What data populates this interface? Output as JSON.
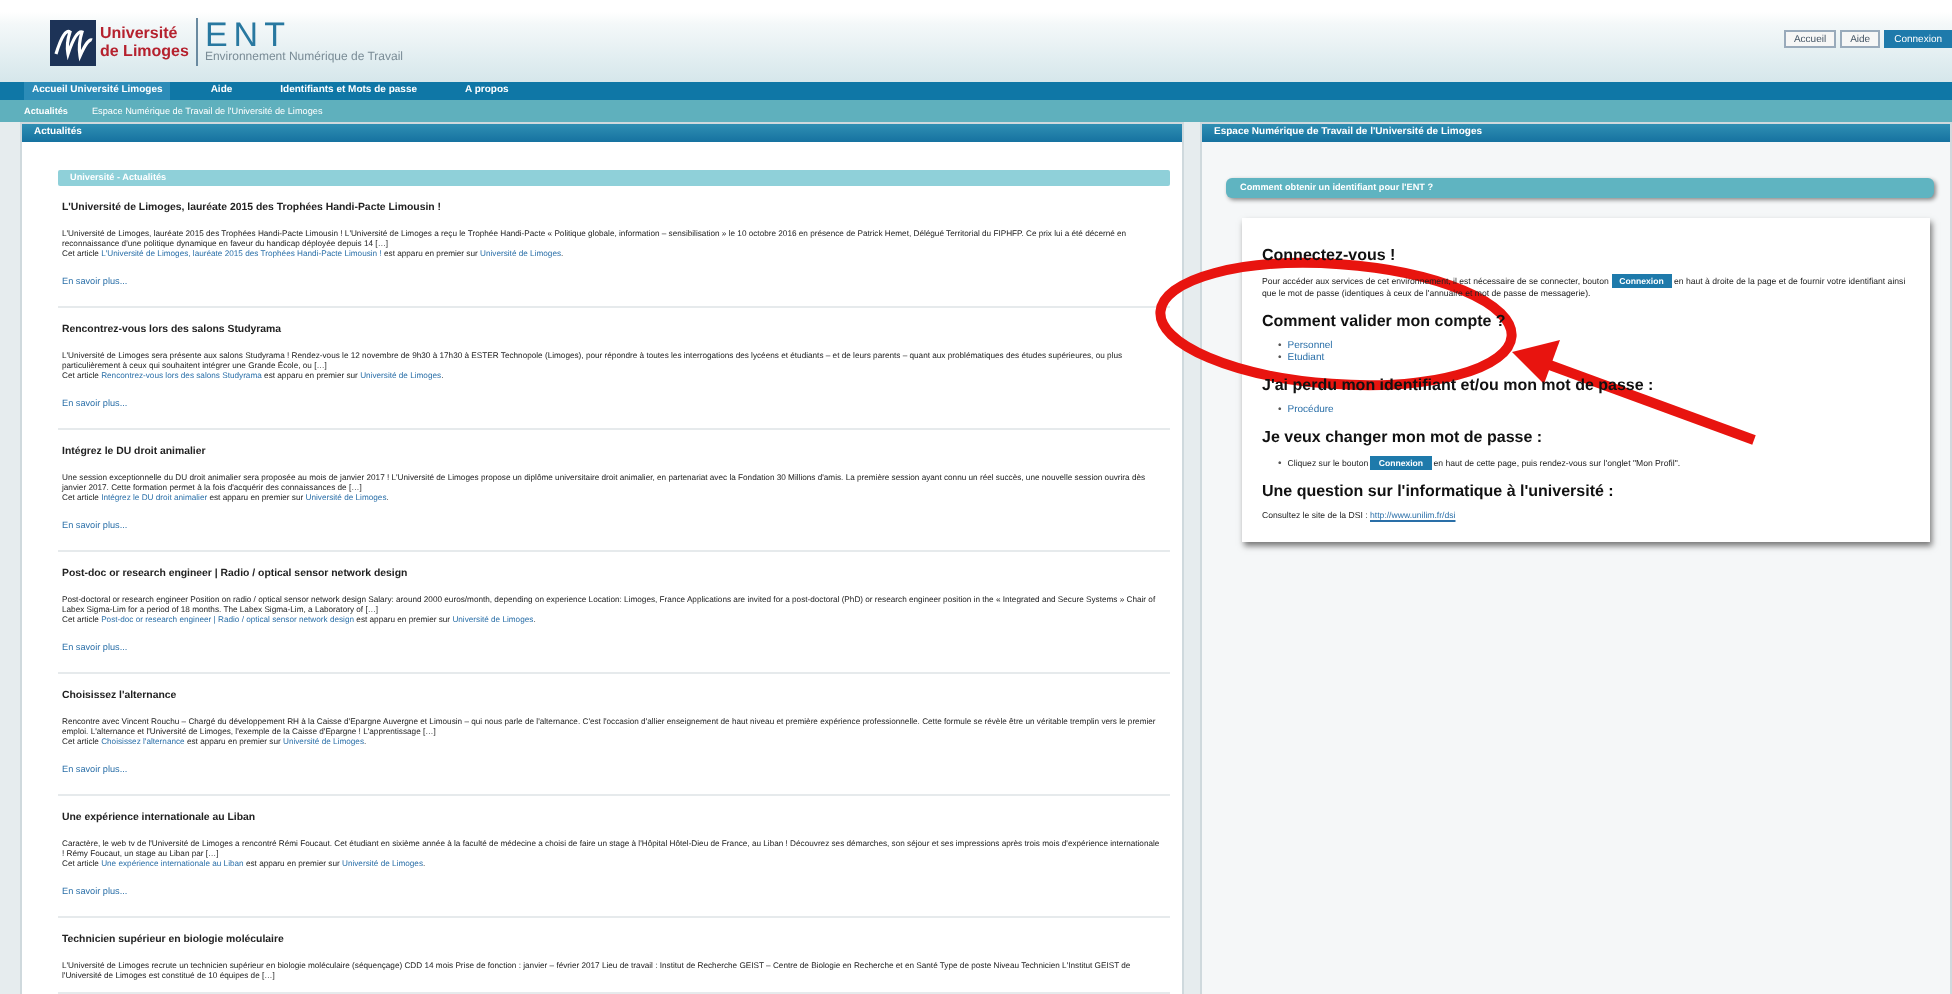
{
  "header": {
    "university": [
      "Université",
      "de Limoges"
    ],
    "app_name": "ENT",
    "app_subtitle": "Environnement Numérique de Travail",
    "top_buttons": [
      {
        "label": "Accueil",
        "selected": false
      },
      {
        "label": "Aide",
        "selected": false
      },
      {
        "label": "Connexion",
        "selected": true
      }
    ]
  },
  "nav": [
    {
      "label": "Accueil Université Limoges",
      "selected": true
    },
    {
      "label": "Aide",
      "selected": false
    },
    {
      "label": "Identifiants et Mots de passe",
      "selected": false
    },
    {
      "label": "A propos",
      "selected": false
    }
  ],
  "subnav": [
    {
      "label": "Actualités",
      "selected": true
    },
    {
      "label": "Espace Numérique de Travail de l'Université de Limoges",
      "selected": false
    }
  ],
  "left_panel": {
    "title": "Actualités",
    "section_title": "Université - Actualités",
    "articles": [
      {
        "title": "L'Université de Limoges, lauréate 2015 des Trophées Handi-Pacte Limousin !",
        "body": "L'Université de Limoges, lauréate 2015 des Trophées Handi-Pacte Limousin ! L'Université de Limoges a reçu le Trophée Handi-Pacte « Politique globale, information – sensibilisation » le 10 octobre 2016 en présence de Patrick Hemet, Délégué Territorial du FIPHFP. Ce prix lui a été décerné en reconnaissance d'une politique dynamique en faveur du handicap déployée depuis 14 […]",
        "cite_prefix": "Cet article",
        "cite_link": "L'Université de Limoges, lauréate 2015 des Trophées Handi-Pacte Limousin !",
        "cite_middle": "est apparu en premier sur",
        "site_link": "Université de Limoges",
        "cite_end": ".",
        "more": "En savoir plus..."
      },
      {
        "title": "Rencontrez-vous lors des salons Studyrama",
        "body": "L'Université de Limoges sera présente aux salons Studyrama ! Rendez-vous le 12 novembre de 9h30 à 17h30 à ESTER Technopole (Limoges), pour répondre à toutes les interrogations des lycéens et étudiants – et de leurs parents – quant aux problématiques des études supérieures, ou plus particulièrement à ceux qui souhaitent intégrer une Grande École, ou […]",
        "cite_prefix": "Cet article",
        "cite_link": "Rencontrez-vous lors des salons Studyrama",
        "cite_middle": "est apparu en premier sur",
        "site_link": "Université de Limoges",
        "cite_end": ".",
        "more": "En savoir plus..."
      },
      {
        "title": "Intégrez le DU droit animalier",
        "body": "Une session exceptionnelle du DU droit animalier sera proposée au mois de janvier 2017 ! L'Université de Limoges propose un diplôme universitaire droit animalier, en partenariat avec la Fondation 30 Millions d'amis. La première session ayant connu un réel succès, une nouvelle session ouvrira dès janvier 2017. Cette formation permet à la fois d'acquérir des connaissances de […]",
        "cite_prefix": "Cet article",
        "cite_link": "Intégrez le DU droit animalier",
        "cite_middle": "est apparu en premier sur",
        "site_link": "Université de Limoges",
        "cite_end": ".",
        "more": "En savoir plus..."
      },
      {
        "title": "Post-doc or research engineer | Radio / optical sensor network design",
        "body": "Post-doctoral or research engineer Position on radio / optical sensor network design Salary: around 2000 euros/month, depending on experience Location: Limoges, France Applications are invited for a post-doctoral (PhD) or research engineer position in the « Integrated and Secure Systems » Chair of Labex Sigma-Lim for a period of 18 months. The Labex Sigma-Lim, a Laboratory of […]",
        "cite_prefix": "Cet article",
        "cite_link": "Post-doc or research engineer | Radio / optical sensor network design",
        "cite_middle": "est apparu en premier sur",
        "site_link": "Université de Limoges",
        "cite_end": ".",
        "more": "En savoir plus..."
      },
      {
        "title": "Choisissez l'alternance",
        "body": "Rencontre avec Vincent Rouchu – Chargé du développement RH à la Caisse d'Epargne Auvergne et Limousin – qui nous parle de l'alternance. C'est l'occasion d'allier enseignement de haut niveau et première expérience professionnelle. Cette formule se révèle être un véritable tremplin vers le premier emploi. L'alternance et l'Université de Limoges, l'exemple de la Caisse d'Epargne ! L'apprentissage […]",
        "cite_prefix": "Cet article",
        "cite_link": "Choisissez l'alternance",
        "cite_middle": "est apparu en premier sur",
        "site_link": "Université de Limoges",
        "cite_end": ".",
        "more": "En savoir plus..."
      },
      {
        "title": "Une expérience internationale au Liban",
        "body": "Caractère, le web tv de l'Université de Limoges a rencontré Rémi Foucaut. Cet étudiant en sixième année à la faculté de médecine a choisi de faire un stage à l'Hôpital Hôtel-Dieu de France, au Liban ! Découvrez ses démarches, son séjour et ses impressions après trois mois d'expérience internationale ! Rémy Foucaut, un stage au Liban par […]",
        "cite_prefix": "Cet article",
        "cite_link": "Une expérience internationale au Liban",
        "cite_middle": "est apparu en premier sur",
        "site_link": "Université de Limoges",
        "cite_end": ".",
        "more": "En savoir plus..."
      },
      {
        "title": "Technicien supérieur en biologie moléculaire",
        "body": "L'Université de Limoges recrute un technicien supérieur en biologie moléculaire (séquençage) CDD 14 mois Prise de fonction : janvier – février 2017 Lieu de travail : Institut de Recherche GEIST – Centre de Biologie en Recherche et en Santé Type de poste Niveau Technicien L'Institut GEIST de l'Université de Limoges est constitué de 10 équipes de […]"
      }
    ]
  },
  "right_panel": {
    "title": "Espace Numérique de Travail de l'Université de Limoges",
    "section_title": "Comment obtenir un identifiant pour l'ENT ?",
    "blocks": [
      {
        "kind": "heading",
        "text": "Connectez-vous !"
      },
      {
        "kind": "paragraph",
        "before": "Pour accéder aux services de cet environnement, il est nécessaire de se connecter, bouton",
        "button": "Connexion",
        "after": "en haut à droite de la page et de fournir votre identifiant ainsi que le mot de passe (identiques à ceux de l'annuaire et mot de passe de messagerie)."
      },
      {
        "kind": "heading",
        "text": "Comment valider mon compte ?"
      },
      {
        "kind": "links",
        "marker": "•",
        "items": [
          "Personnel",
          "Etudiant"
        ]
      },
      {
        "kind": "heading",
        "text": "J'ai perdu mon identifiant et/ou mon mot de passe :"
      },
      {
        "kind": "links",
        "marker": "•",
        "items": [
          "Procédure"
        ]
      },
      {
        "kind": "heading",
        "text": "Je veux changer mon mot de passe :"
      },
      {
        "kind": "bullet",
        "marker": "•",
        "before": "Cliquez sur le bouton",
        "button": "Connexion",
        "after": "en haut de cette page, puis rendez-vous sur l'onglet \"Mon Profil\"."
      },
      {
        "kind": "heading",
        "text": "Une question sur l'informatique à l'université :"
      },
      {
        "kind": "contact",
        "before": "Consultez le site de la DSI :",
        "link": "http://www.unilim.fr/dsi"
      }
    ]
  }
}
